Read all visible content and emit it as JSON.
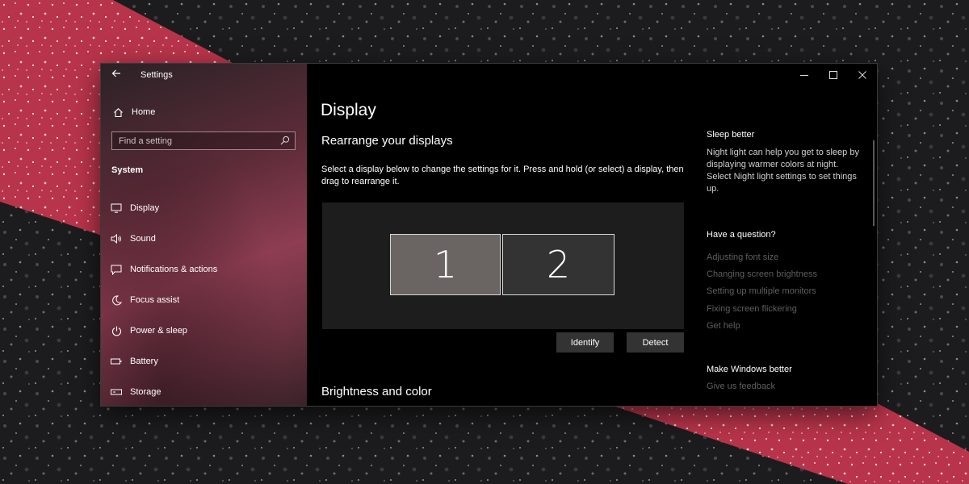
{
  "window": {
    "title": "Settings"
  },
  "sidebar": {
    "home_label": "Home",
    "search_placeholder": "Find a setting",
    "section_title": "System",
    "items": [
      {
        "label": "Display",
        "icon": "monitor-icon"
      },
      {
        "label": "Sound",
        "icon": "speaker-icon"
      },
      {
        "label": "Notifications & actions",
        "icon": "notification-icon"
      },
      {
        "label": "Focus assist",
        "icon": "moon-icon"
      },
      {
        "label": "Power & sleep",
        "icon": "power-icon"
      },
      {
        "label": "Battery",
        "icon": "battery-icon"
      },
      {
        "label": "Storage",
        "icon": "storage-icon"
      }
    ]
  },
  "main": {
    "page_title": "Display",
    "rearrange_heading": "Rearrange your displays",
    "instructions": "Select a display below to change the settings for it. Press and hold (or select) a display, then drag to rearrange it.",
    "monitors": [
      "1",
      "2"
    ],
    "identify_label": "Identify",
    "detect_label": "Detect",
    "brightness_heading": "Brightness and color"
  },
  "right_panel": {
    "sleep_title": "Sleep better",
    "sleep_text": "Night light can help you get to sleep by displaying warmer colors at night. Select Night light settings to set things up.",
    "question_title": "Have a question?",
    "links": [
      "Adjusting font size",
      "Changing screen brightness",
      "Setting up multiple monitors",
      "Fixing screen flickering",
      "Get help"
    ],
    "windows_better_title": "Make Windows better",
    "feedback_link": "Give us feedback"
  },
  "colors": {
    "sidebar_accent": "#8e3d52",
    "content_bg": "#000000",
    "monitor_selected": "#6a6462",
    "monitor_unselected": "#333333",
    "link_disabled": "#5f5f5f"
  }
}
